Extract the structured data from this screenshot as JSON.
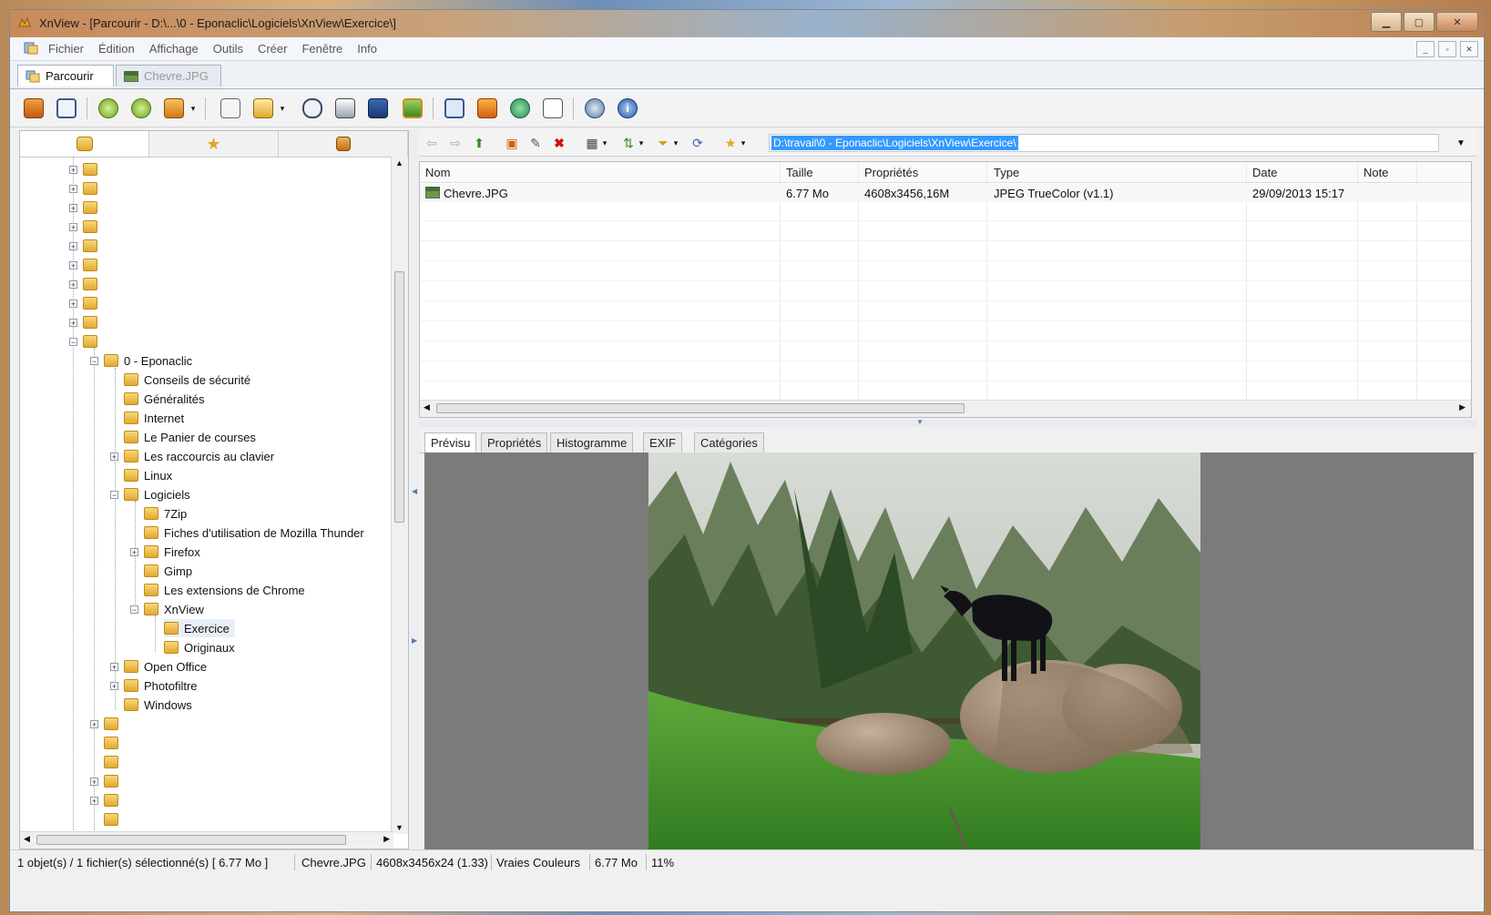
{
  "window": {
    "title": "XnView - [Parcourir - D:\\...\\0 - Eponaclic\\Logiciels\\XnView\\Exercice\\]"
  },
  "menu": [
    "Fichier",
    "Édition",
    "Affichage",
    "Outils",
    "Créer",
    "Fenêtre",
    "Info"
  ],
  "tabs": [
    {
      "label": "Parcourir"
    },
    {
      "label": "Chevre.JPG"
    }
  ],
  "path": "D:\\travail\\0 - Eponaclic\\Logiciels\\XnView\\Exercice\\",
  "tree": {
    "root_label": "0 - Eponaclic",
    "children": [
      "Conseils de sécurité",
      "Généralités",
      "Internet",
      "Le Panier de courses",
      "Les raccourcis au clavier",
      "Linux",
      "Logiciels"
    ],
    "logiciels_children": [
      "7Zip",
      "Fiches d'utilisation de Mozilla Thunder",
      "Firefox",
      "Gimp",
      "Les extensions de Chrome",
      "XnView"
    ],
    "xnview_children": [
      "Exercice",
      "Originaux"
    ],
    "after": [
      "Open Office",
      "Photofiltre",
      "Windows"
    ]
  },
  "filelist": {
    "columns": [
      "Nom",
      "Taille",
      "Propriétés",
      "Type",
      "Date",
      "Note"
    ],
    "rows": [
      {
        "name": "Chevre.JPG",
        "size": "6.77 Mo",
        "props": "4608x3456,16M",
        "type": "JPEG TrueColor (v1.1)",
        "date": "29/09/2013 15:17"
      }
    ]
  },
  "preview_tabs": [
    "Prévisu",
    "Propriétés",
    "Histogramme",
    "EXIF",
    "Catégories"
  ],
  "status": {
    "selection": "1 objet(s) / 1 fichier(s) sélectionné(s)  [ 6.77 Mo ]",
    "filename": "Chevre.JPG",
    "dims": "4608x3456x24 (1.33)",
    "colors": "Vraies Couleurs",
    "size": "6.77 Mo",
    "zoom": "11%"
  }
}
